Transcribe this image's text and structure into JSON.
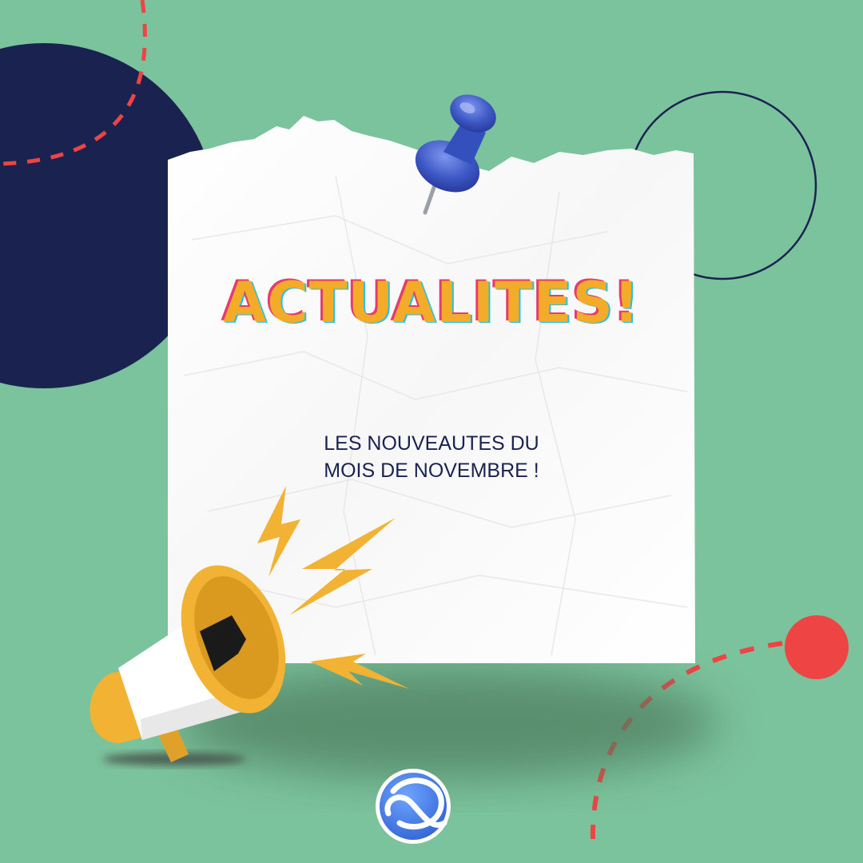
{
  "poster": {
    "title": "ACTUALITES!",
    "subtitle_line1": "LES NOUVEAUTES DU",
    "subtitle_line2": "MOIS DE NOVEMBRE !"
  },
  "colors": {
    "background": "#7bc39c",
    "navy": "#1a2350",
    "title_orange": "#f2ac29",
    "accent_red": "#ee4444",
    "pin_blue": "#3c57c4",
    "megaphone_yellow": "#f2b233",
    "logo_blue": "#4a7fe0"
  },
  "icons": [
    "pushpin-icon",
    "megaphone-icon",
    "lightning-bolt-icon",
    "logo-icon"
  ]
}
